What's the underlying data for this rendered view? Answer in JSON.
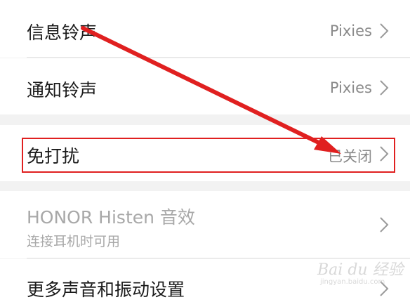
{
  "settings": {
    "message_ringtone": {
      "label": "信息铃声",
      "value": "Pixies"
    },
    "notification_ringtone": {
      "label": "通知铃声",
      "value": "Pixies"
    },
    "do_not_disturb": {
      "label": "免打扰",
      "value": "已关闭"
    },
    "histen": {
      "label": "HONOR Histen 音效",
      "sublabel": "连接耳机时可用"
    },
    "more_sound": {
      "label": "更多声音和振动设置"
    }
  },
  "watermark": {
    "brand": "Bai du 经验",
    "url": "jingyan.baidu.com"
  },
  "colors": {
    "annotation_red": "#e02020",
    "background": "#f2f2f2",
    "row": "#ffffff",
    "secondary_text": "#8a8a8a",
    "disabled_text": "#a8a8a8"
  },
  "icons": [
    "chevron-right-icon",
    "annotation-arrow",
    "baidu-paw-icon"
  ]
}
